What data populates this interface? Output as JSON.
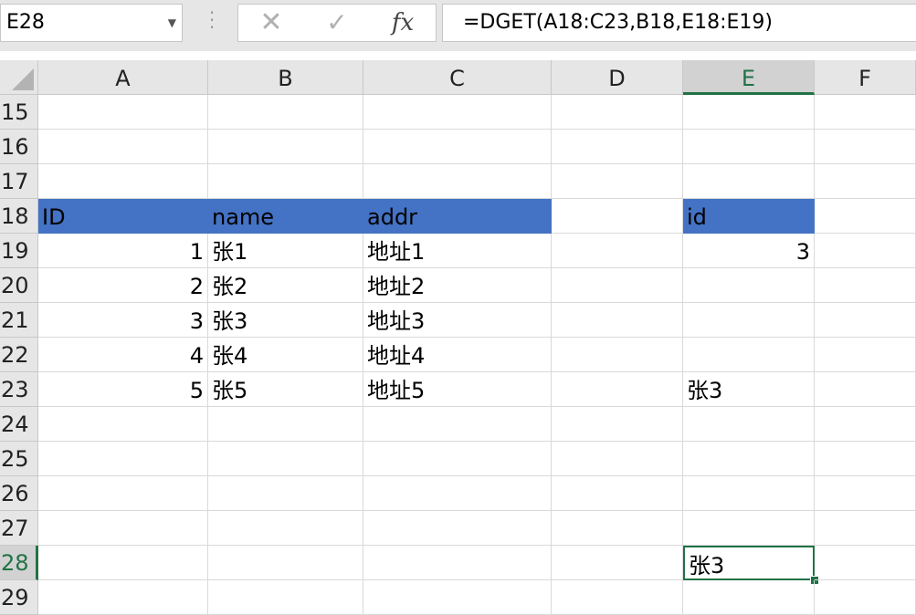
{
  "formula_bar": {
    "name_box": "E28",
    "cancel_icon": "✕",
    "enter_icon": "✓",
    "insert_function_label": "fx",
    "formula": "=DGET(A18:C23,B18,E18:E19)"
  },
  "columns": [
    "A",
    "B",
    "C",
    "D",
    "E",
    "F"
  ],
  "active_column": "E",
  "rows": [
    "15",
    "16",
    "17",
    "18",
    "19",
    "20",
    "21",
    "22",
    "23",
    "24",
    "25",
    "26",
    "27",
    "28",
    "29"
  ],
  "active_row": "28",
  "colors": {
    "header_fill": "#4472c4",
    "selection": "#217346"
  },
  "cells": {
    "A18": "ID",
    "B18": "name",
    "C18": "addr",
    "A19": "1",
    "B19": "张1",
    "C19": "地址1",
    "A20": "2",
    "B20": "张2",
    "C20": "地址2",
    "A21": "3",
    "B21": "张3",
    "C21": "地址3",
    "A22": "4",
    "B22": "张4",
    "C22": "地址4",
    "A23": "5",
    "B23": "张5",
    "C23": "地址5",
    "E18": "id",
    "E19": "3",
    "E23": "张3",
    "E28": "张3"
  }
}
